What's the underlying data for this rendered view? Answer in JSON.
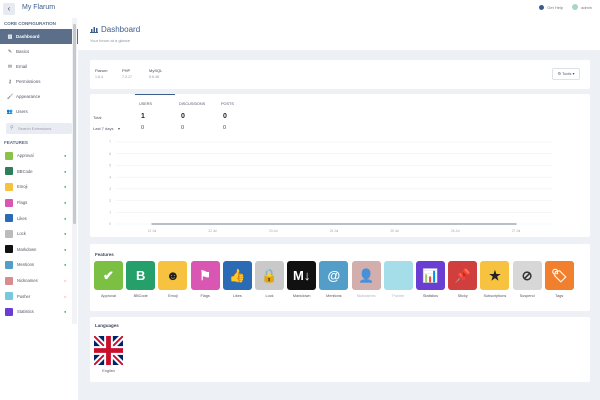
{
  "topbar": {
    "forum_name": "My Flarum",
    "get_help": "Get Help",
    "admin": "admin"
  },
  "sidebar": {
    "core_heading": "CORE CONFIGURATION",
    "items": [
      {
        "label": "Dashboard",
        "icon": "chart-icon"
      },
      {
        "label": "Basics",
        "icon": "pencil-icon"
      },
      {
        "label": "Email",
        "icon": "envelope-icon"
      },
      {
        "label": "Permissions",
        "icon": "key-icon"
      },
      {
        "label": "Appearance",
        "icon": "paintbrush-icon"
      },
      {
        "label": "Users",
        "icon": "users-icon"
      }
    ],
    "search_placeholder": "Search Extensions",
    "features_heading": "FEATURES",
    "extensions": [
      {
        "label": "Approval",
        "color": "#8bc34a",
        "enabled": true
      },
      {
        "label": "BBCode",
        "color": "#2e7d5b",
        "enabled": true
      },
      {
        "label": "Emoji",
        "color": "#f7c23f",
        "enabled": true
      },
      {
        "label": "Flags",
        "color": "#d956b2",
        "enabled": true
      },
      {
        "label": "Likes",
        "color": "#2b6bb5",
        "enabled": true
      },
      {
        "label": "Lock",
        "color": "#bbbbbb",
        "enabled": true
      },
      {
        "label": "Markdown",
        "color": "#111111",
        "enabled": true
      },
      {
        "label": "Mentions",
        "color": "#539ec9",
        "enabled": true
      },
      {
        "label": "Nicknames",
        "color": "#d98c8c",
        "enabled": false
      },
      {
        "label": "Pusher",
        "color": "#77c8da",
        "enabled": false
      },
      {
        "label": "Statistics",
        "color": "#6a3dd3",
        "enabled": true
      }
    ]
  },
  "header": {
    "title": "Dashboard",
    "subtitle": "Your forum at a glance"
  },
  "versions": {
    "items": [
      {
        "name": "Flarum",
        "value": "1.6.4"
      },
      {
        "name": "PHP",
        "value": "7.2.17"
      },
      {
        "name": "MySQL",
        "value": "5.6.46"
      }
    ],
    "tools_label": "Tools"
  },
  "stats": {
    "tabs": [
      "USERS",
      "DISCUSSIONS",
      "POSTS"
    ],
    "rows": [
      {
        "label": "Total",
        "values": [
          "1",
          "0",
          "0"
        ]
      },
      {
        "label": "Last 7 days",
        "values": [
          "0",
          "0",
          "0"
        ]
      }
    ]
  },
  "chart_data": {
    "type": "line",
    "categories": [
      "21 Jul",
      "22 Jul",
      "23 Jul",
      "24 Jul",
      "25 Jul",
      "26 Jul",
      "27 Jul"
    ],
    "series": [
      {
        "values": [
          0,
          0,
          0,
          0,
          0,
          0,
          0
        ]
      }
    ],
    "y_ticks": [
      "7",
      "6",
      "5",
      "4",
      "3",
      "2",
      "1",
      "0"
    ],
    "ylim": [
      0,
      7
    ],
    "grid": true
  },
  "features": {
    "heading": "Features",
    "tiles": [
      {
        "label": "Approval",
        "color": "#7bc043",
        "glyph": "✔",
        "enabled": true
      },
      {
        "label": "BBCode",
        "color": "#26a06a",
        "glyph": "B",
        "enabled": true
      },
      {
        "label": "Emoji",
        "color": "#f7c23f",
        "glyph": "☻",
        "enabled": true
      },
      {
        "label": "Flags",
        "color": "#d956b2",
        "glyph": "⚑",
        "enabled": true
      },
      {
        "label": "Likes",
        "color": "#2b6bb5",
        "glyph": "👍",
        "enabled": true
      },
      {
        "label": "Lock",
        "color": "#c9c9c9",
        "glyph": "🔒",
        "enabled": true
      },
      {
        "label": "Markdown",
        "color": "#111111",
        "glyph": "M↓",
        "enabled": true
      },
      {
        "label": "Mentions",
        "color": "#539ec9",
        "glyph": "@",
        "enabled": true
      },
      {
        "label": "Nicknames",
        "color": "#c79c99",
        "glyph": "👤",
        "enabled": false
      },
      {
        "label": "Pusher",
        "color": "#8fd4e4",
        "glyph": "",
        "enabled": false
      },
      {
        "label": "Statistics",
        "color": "#6a3dd3",
        "glyph": "📊",
        "enabled": true
      },
      {
        "label": "Sticky",
        "color": "#d13e3e",
        "glyph": "📌",
        "enabled": true
      },
      {
        "label": "Subscriptions",
        "color": "#f7c23f",
        "glyph": "★",
        "enabled": true
      },
      {
        "label": "Suspend",
        "color": "#d7d7d7",
        "glyph": "⊘",
        "enabled": true
      },
      {
        "label": "Tags",
        "color": "#f07f2e",
        "glyph": "🏷",
        "enabled": true
      }
    ]
  },
  "languages": {
    "heading": "Languages",
    "items": [
      {
        "label": "English"
      }
    ]
  }
}
